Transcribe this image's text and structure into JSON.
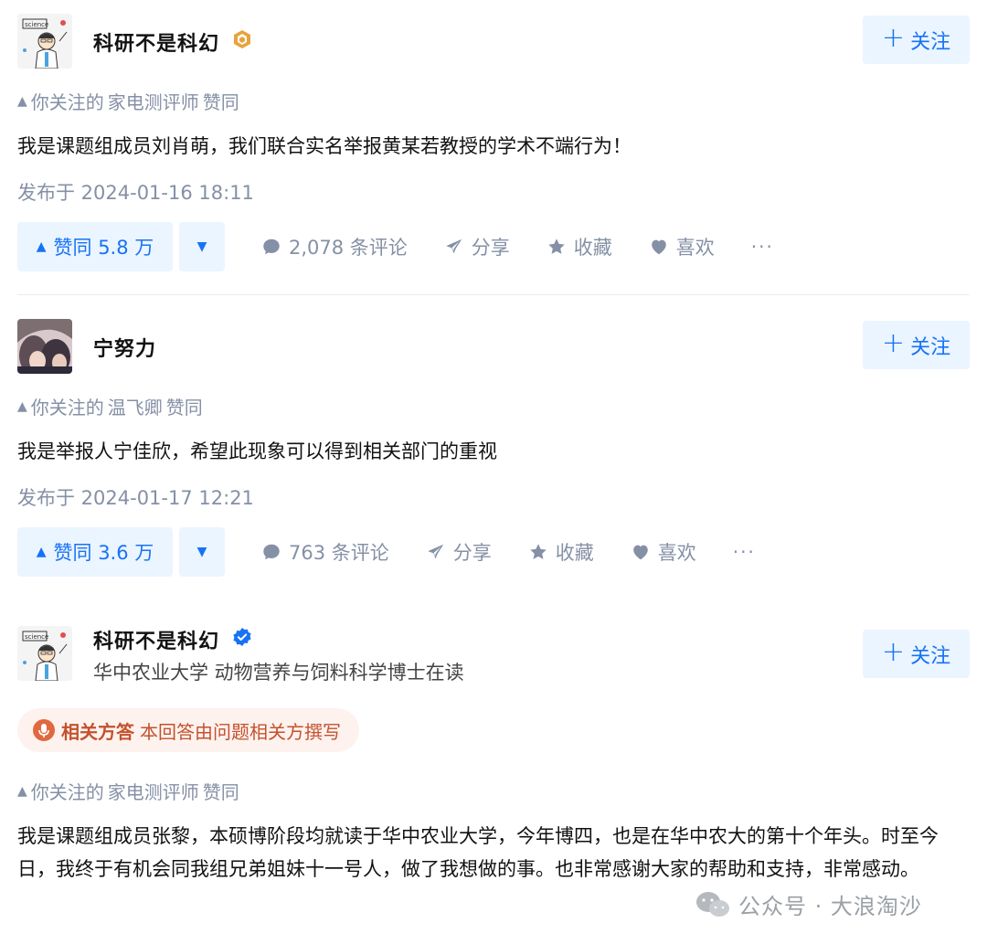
{
  "answers": [
    {
      "author": {
        "name": "科研不是科幻",
        "badge_icon": "gold-hexagon-badge-icon",
        "bio": ""
      },
      "follow_label": "关注",
      "upvoted_by": {
        "prefix": "你关注的",
        "user": "家电测评师",
        "suffix": "赞同"
      },
      "content": "我是课题组成员刘肖萌，我们联合实名举报黄某若教授的学术不端行为！",
      "published": "发布于 2024-01-16 18:11",
      "actions": {
        "upvote": "赞同 5.8 万",
        "comments": "2,078 条评论",
        "share": "分享",
        "favorite": "收藏",
        "like": "喜欢",
        "more": "···"
      }
    },
    {
      "author": {
        "name": "宁努力",
        "badge_icon": "",
        "bio": ""
      },
      "follow_label": "关注",
      "upvoted_by": {
        "prefix": "你关注的",
        "user": "温飞卿",
        "suffix": "赞同"
      },
      "content": "我是举报人宁佳欣，希望此现象可以得到相关部门的重视",
      "published": "发布于 2024-01-17 12:21",
      "actions": {
        "upvote": "赞同 3.6 万",
        "comments": "763 条评论",
        "share": "分享",
        "favorite": "收藏",
        "like": "喜欢",
        "more": "···"
      }
    },
    {
      "author": {
        "name": "科研不是科幻",
        "badge_icon": "blue-verified-badge-icon",
        "bio": "华中农业大学 动物营养与饲料科学博士在读"
      },
      "follow_label": "关注",
      "related_tag": {
        "title": "相关方答",
        "desc": "本回答由问题相关方撰写"
      },
      "upvoted_by": {
        "prefix": "你关注的",
        "user": "家电测评师",
        "suffix": "赞同"
      },
      "content": "我是课题组成员张黎，本硕博阶段均就读于华中农业大学，今年博四，也是在华中农大的第十个年头。时至今日，我终于有机会同我组兄弟姐妹十一号人，做了我想做的事。也非常感谢大家的帮助和支持，非常感动。"
    }
  ],
  "watermark": "公众号 · 大浪淘沙",
  "colors": {
    "accent": "#1772f6",
    "accent_bg": "#ebf5ff",
    "muted": "#8590a6",
    "tag": "#c4512e",
    "tag_bg": "#fdf2ee"
  }
}
